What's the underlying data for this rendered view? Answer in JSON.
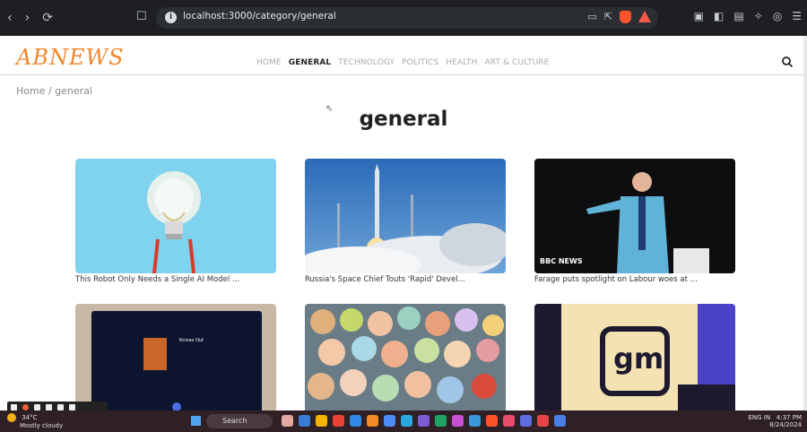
{
  "browser": {
    "url": "localhost:3000/category/general",
    "nav_back": "‹",
    "nav_forward": "›",
    "nav_reload": "⟳",
    "bookmark_icon": "bookmark-icon"
  },
  "site": {
    "logo": "ABNEWS",
    "menu": [
      "HOME",
      "GENERAL",
      "TECHNOLOGY",
      "POLITICS",
      "HEALTH",
      "ART & CULTURE"
    ],
    "active_menu": "GENERAL",
    "breadcrumb": "Home / general",
    "page_title": "general"
  },
  "articles": [
    {
      "caption": "This Robot Only Needs a Single AI Model ..."
    },
    {
      "caption": "Russia's Space Chief Touts 'Rapid' Devel..."
    },
    {
      "caption": "Farage puts spotlight on Labour woes at ..."
    },
    {
      "caption": ""
    },
    {
      "caption": ""
    },
    {
      "caption": ""
    }
  ],
  "article_image_text": {
    "bbc": "BBC NEWS",
    "gm": "gm",
    "movie_title": "Knives Out"
  },
  "taskbar": {
    "weather_temp": "34°C",
    "weather_desc": "Mostly cloudy",
    "search_label": "Search",
    "time": "4:37 PM",
    "date": "8/24/2024",
    "lang": "ENG IN"
  }
}
